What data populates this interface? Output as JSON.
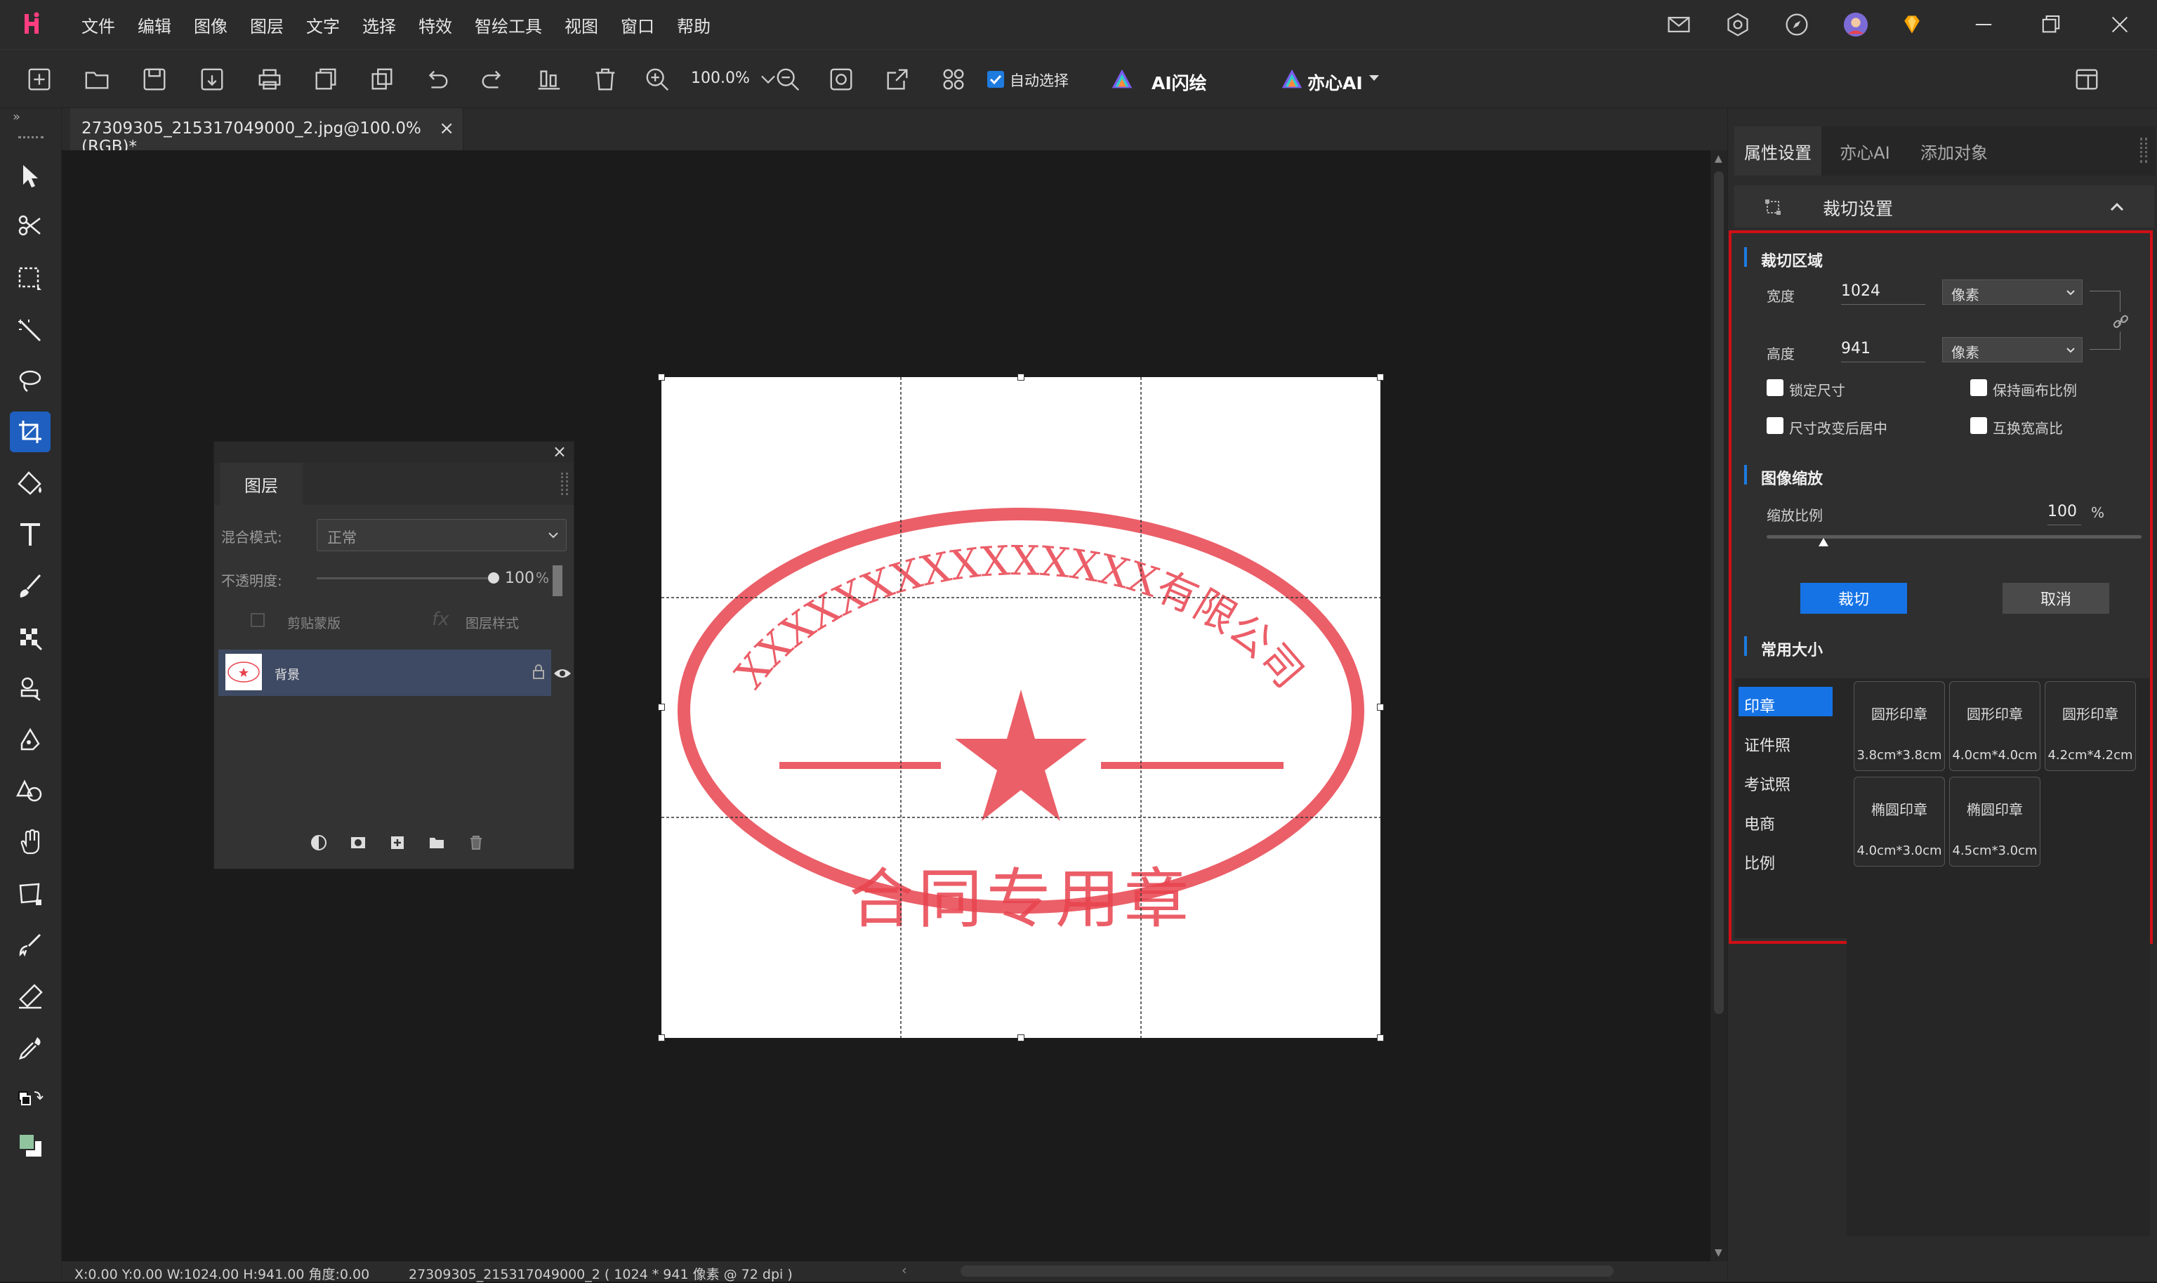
{
  "menu": [
    "文件",
    "编辑",
    "图像",
    "图层",
    "文字",
    "选择",
    "特效",
    "智绘工具",
    "视图",
    "窗口",
    "帮助"
  ],
  "toolbar": {
    "zoom": "100.0%",
    "auto_select": "自动选择",
    "ai_flash": "AI闪绘",
    "yixin_ai": "亦心AI"
  },
  "document": {
    "tab_title": "27309305_215317049000_2.jpg@100.0% (RGB)*"
  },
  "layers_panel": {
    "title": "图层",
    "blend_label": "混合模式:",
    "blend_value": "正常",
    "opacity_label": "不透明度:",
    "opacity_value": "100",
    "opacity_unit": "%",
    "opacity_fraction": 1.0,
    "clip_mask": "剪贴蒙版",
    "layer_style": "图层样式",
    "layer_name": "背景"
  },
  "stamp": {
    "arc_text": "XXXXXXXXXXXXXXX有限公司",
    "bottom_text": "合同专用章",
    "color": "#e8434e"
  },
  "right_panel": {
    "tabs": [
      "属性设置",
      "亦心AI",
      "添加对象"
    ],
    "crop_header": "裁切设置",
    "crop_area": "裁切区域",
    "width_label": "宽度",
    "width_value": "1024",
    "height_label": "高度",
    "height_value": "941",
    "unit": "像素",
    "lock_size": "锁定尺寸",
    "keep_ratio": "保持画布比例",
    "center_after": "尺寸改变后居中",
    "swap": "互换宽高比",
    "scale_title": "图像缩放",
    "scale_label": "缩放比例",
    "scale_value": "100",
    "scale_unit": "%",
    "crop_btn": "裁切",
    "cancel_btn": "取消",
    "common_sizes": "常用大小",
    "categories": [
      "印章",
      "证件照",
      "考试照",
      "电商",
      "比例"
    ],
    "cards": [
      {
        "name": "圆形印章",
        "dim": "3.8cm*3.8cm"
      },
      {
        "name": "圆形印章",
        "dim": "4.0cm*4.0cm"
      },
      {
        "name": "圆形印章",
        "dim": "4.2cm*4.2cm"
      },
      {
        "name": "椭圆印章",
        "dim": "4.0cm*3.0cm"
      },
      {
        "name": "椭圆印章",
        "dim": "4.5cm*3.0cm"
      }
    ]
  },
  "status": {
    "coords": "X:0.00 Y:0.00 W:1024.00 H:941.00 角度:0.00",
    "file": "27309305_215317049000_2 ( 1024 * 941 像素 @ 72 dpi )"
  },
  "colors": {
    "accent": "#1573e6",
    "highlight_border": "#d10f16",
    "stamp_red": "#e8434e"
  }
}
